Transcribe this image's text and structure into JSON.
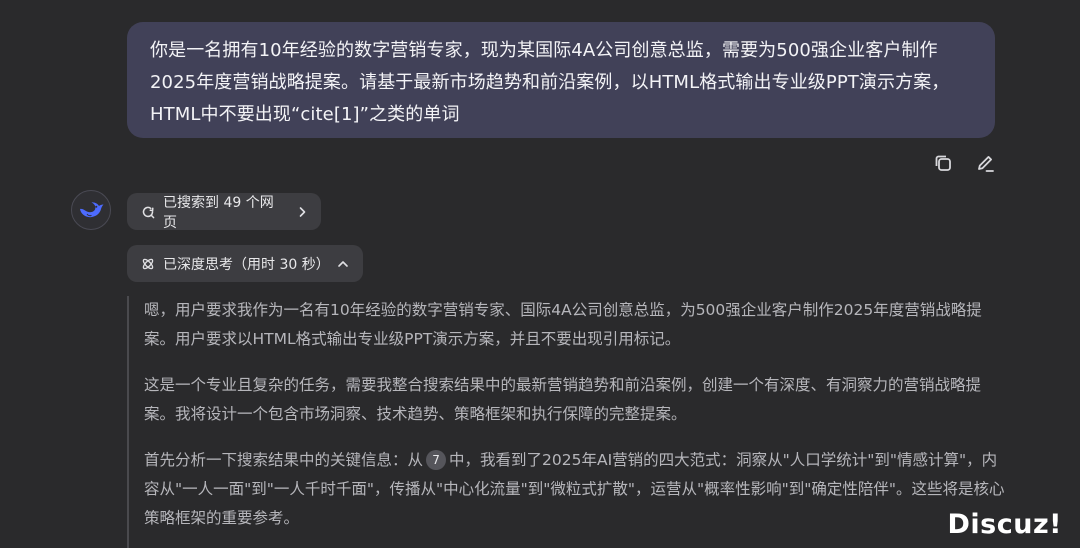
{
  "user_message": {
    "lines": [
      "你是一名拥有10年经验的数字营销专家，现为某国际4A公司创意总监，需要为500强企业客户制作",
      "2025年度营销战略提案。请基于最新市场趋势和前沿案例，以HTML格式输出专业级PPT演示方案，",
      "HTML中不要出现“cite[1]”之类的单词"
    ]
  },
  "actions": {
    "copy_icon": "copy-icon",
    "edit_icon": "edit-icon"
  },
  "assistant": {
    "avatar_icon": "deepseek-whale-icon",
    "search_chip": "已搜索到 49 个网页",
    "think_chip": "已深度思考（用时 30 秒）",
    "thinking": {
      "p1": "嗯，用户要求我作为一名有10年经验的数字营销专家、国际4A公司创意总监，为500强企业客户制作2025年度营销战略提案。用户要求以HTML格式输出专业级PPT演示方案，并且不要出现引用标记。",
      "p2": "这是一个专业且复杂的任务，需要我整合搜索结果中的最新营销趋势和前沿案例，创建一个有深度、有洞察力的营销战略提案。我将设计一个包含市场洞察、技术趋势、策略框架和执行保障的完整提案。",
      "p3_before": "首先分析一下搜索结果中的关键信息：从",
      "p3_cite": "7",
      "p3_after": "中，我看到了2025年AI营销的四大范式：洞察从\"人口学统计\"到\"情感计算\"，内容从\"一人一面\"到\"一人千时千面\"，传播从\"中心化流量\"到\"微粒式扩散\"，运营从\"概率性影响\"到\"确定性陪伴\"。这些将是核心策略框架的重要参考。"
    }
  },
  "watermark": "Discuz!",
  "colors": {
    "background": "#2a2a2c",
    "user_bubble": "#414158",
    "chip": "#3d3d41",
    "thinking_text": "#b6b6bb",
    "avatar_accent": "#4d6bfe"
  }
}
